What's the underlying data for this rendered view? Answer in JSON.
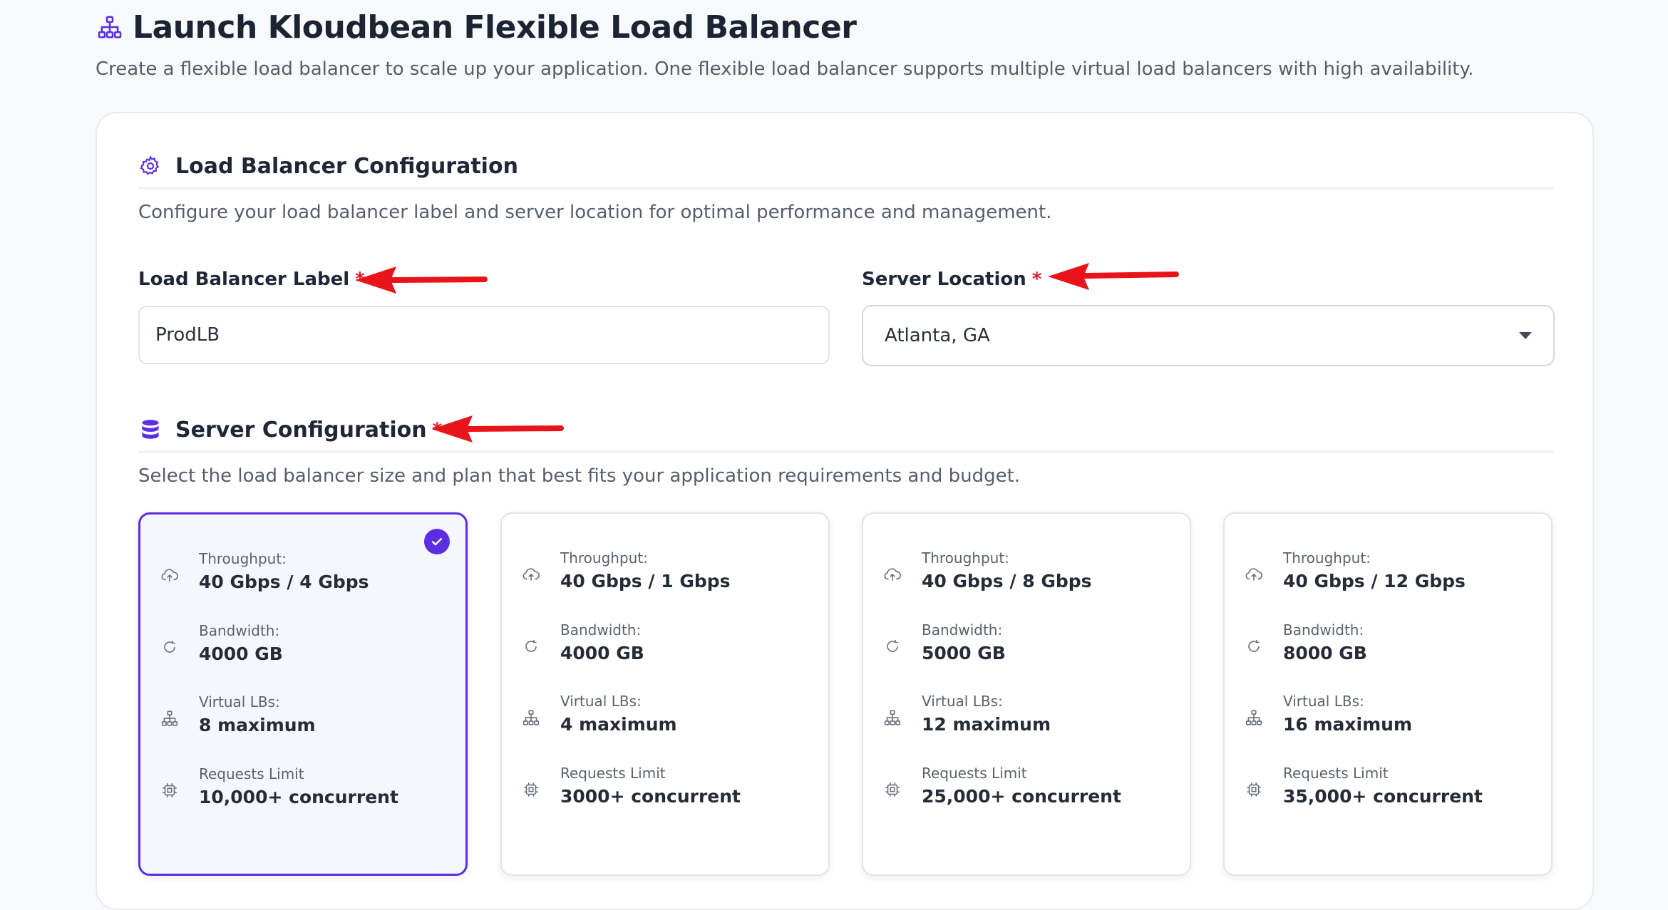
{
  "page": {
    "title": "Launch Kloudbean Flexible Load Balancer",
    "subtitle": "Create a flexible load balancer to scale up your application. One flexible load balancer supports multiple virtual load balancers with high availability.",
    "title_icon": "network-icon"
  },
  "lb_config": {
    "title": "Load Balancer Configuration",
    "icon": "gear-icon",
    "description": "Configure your load balancer label and server location for optimal performance and management.",
    "label_field": {
      "label": "Load Balancer Label",
      "required": "*",
      "value": "ProdLB"
    },
    "location_field": {
      "label": "Server Location",
      "required": "*",
      "selected": "Atlanta, GA"
    }
  },
  "server_config": {
    "title": "Server Configuration",
    "required": "*",
    "icon": "database-icon",
    "description": "Select the load balancer size and plan that best fits your application requirements and budget.",
    "plans": [
      {
        "selected": true,
        "throughput_label": "Throughput:",
        "throughput": "40 Gbps / 4 Gbps",
        "bandwidth_label": "Bandwidth:",
        "bandwidth": "4000 GB",
        "vlbs_label": "Virtual LBs:",
        "vlbs": "8 maximum",
        "requests_label": "Requests Limit",
        "requests": "10,000+ concurrent"
      },
      {
        "selected": false,
        "throughput_label": "Throughput:",
        "throughput": "40 Gbps / 1 Gbps",
        "bandwidth_label": "Bandwidth:",
        "bandwidth": "4000 GB",
        "vlbs_label": "Virtual LBs:",
        "vlbs": "4 maximum",
        "requests_label": "Requests Limit",
        "requests": "3000+ concurrent"
      },
      {
        "selected": false,
        "throughput_label": "Throughput:",
        "throughput": "40 Gbps / 8 Gbps",
        "bandwidth_label": "Bandwidth:",
        "bandwidth": "5000 GB",
        "vlbs_label": "Virtual LBs:",
        "vlbs": "12 maximum",
        "requests_label": "Requests Limit",
        "requests": "25,000+ concurrent"
      },
      {
        "selected": false,
        "throughput_label": "Throughput:",
        "throughput": "40 Gbps / 12 Gbps",
        "bandwidth_label": "Bandwidth:",
        "bandwidth": "8000 GB",
        "vlbs_label": "Virtual LBs:",
        "vlbs": "16 maximum",
        "requests_label": "Requests Limit",
        "requests": "35,000+ concurrent"
      }
    ]
  },
  "colors": {
    "accent": "#5b2ee3",
    "required": "#e11d2e",
    "annotation_arrow": "#e8141a"
  }
}
